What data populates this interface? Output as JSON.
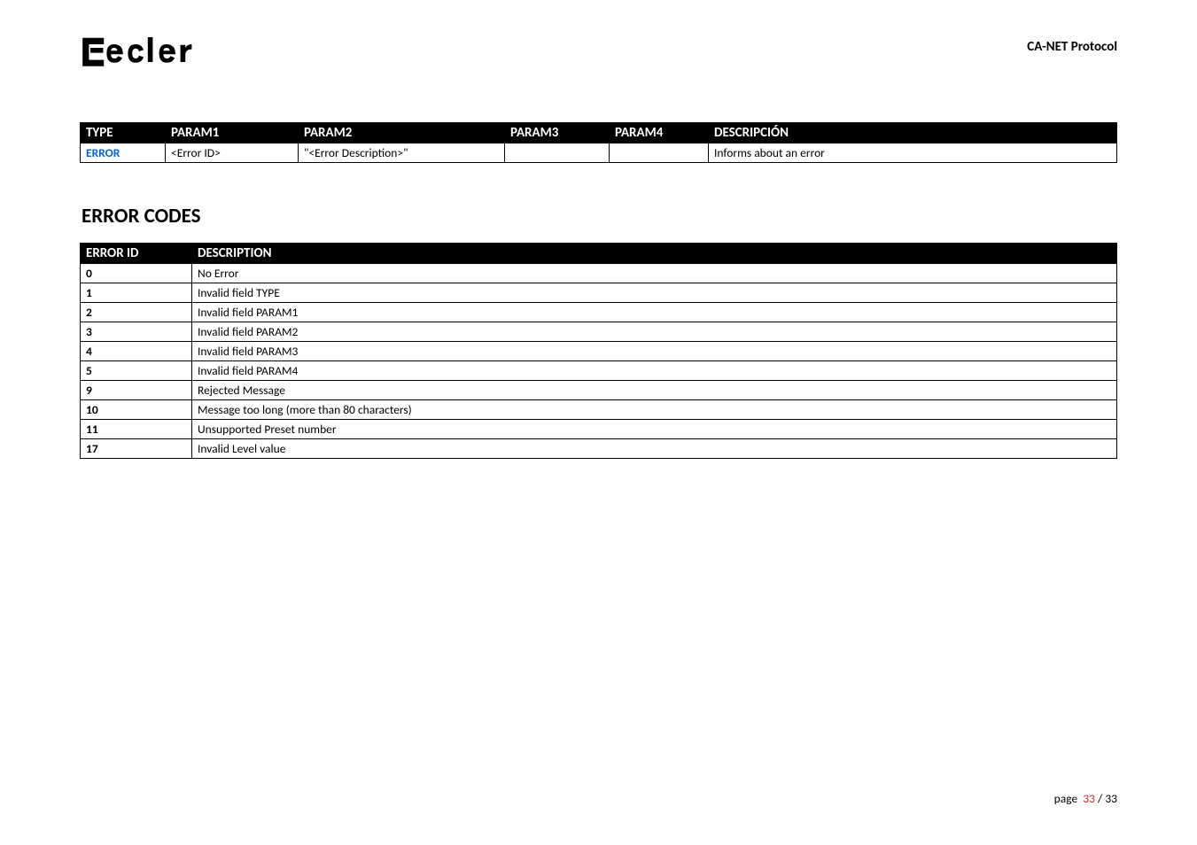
{
  "header": {
    "protocol_label": "CA-NET Protocol"
  },
  "table1": {
    "headers": {
      "type": "TYPE",
      "param1": "PARAM1",
      "param2": "PARAM2",
      "param3": "PARAM3",
      "param4": "PARAM4",
      "descripcion": "DESCRIPCIÓN"
    },
    "row": {
      "type": "ERROR",
      "param1": "<Error ID>",
      "param2": "\"<Error Description>\"",
      "param3": "",
      "param4": "",
      "descripcion": "Informs about an error"
    }
  },
  "section_title": "ERROR CODES",
  "table2": {
    "headers": {
      "error_id": "ERROR ID",
      "description": "DESCRIPTION"
    },
    "rows": [
      {
        "id": "0",
        "desc": "No Error"
      },
      {
        "id": "1",
        "desc": "Invalid field TYPE"
      },
      {
        "id": "2",
        "desc": "Invalid field PARAM1"
      },
      {
        "id": "3",
        "desc": "Invalid field PARAM2"
      },
      {
        "id": "4",
        "desc": "Invalid field PARAM3"
      },
      {
        "id": "5",
        "desc": "Invalid field PARAM4"
      },
      {
        "id": "9",
        "desc": "Rejected Message"
      },
      {
        "id": "10",
        "desc": "Message too long (more than 80 characters)"
      },
      {
        "id": "11",
        "desc": "Unsupported Preset number"
      },
      {
        "id": "17",
        "desc": "Invalid Level value"
      }
    ]
  },
  "footer": {
    "label": "page",
    "current": "33",
    "sep": " / ",
    "total": "33"
  }
}
